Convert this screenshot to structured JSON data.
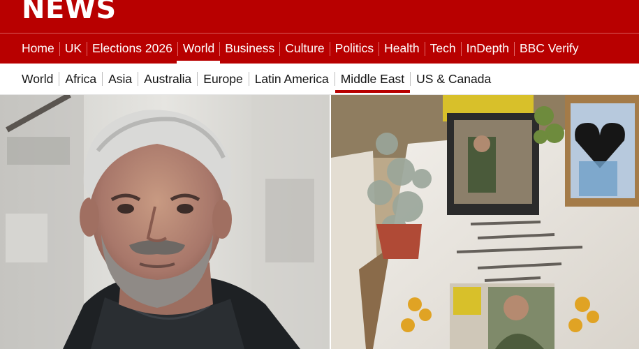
{
  "brand": {
    "logo_text": "NEWS",
    "color": "#b80000"
  },
  "primary_nav": {
    "active": "World",
    "items": [
      {
        "label": "Home"
      },
      {
        "label": "UK"
      },
      {
        "label": "Elections 2026"
      },
      {
        "label": "World"
      },
      {
        "label": "Business"
      },
      {
        "label": "Culture"
      },
      {
        "label": "Politics"
      },
      {
        "label": "Health"
      },
      {
        "label": "Tech"
      },
      {
        "label": "InDepth"
      },
      {
        "label": "BBC Verify"
      }
    ]
  },
  "secondary_nav": {
    "active": "Middle East",
    "items": [
      {
        "label": "World"
      },
      {
        "label": "Africa"
      },
      {
        "label": "Asia"
      },
      {
        "label": "Australia"
      },
      {
        "label": "Europe"
      },
      {
        "label": "Latin America"
      },
      {
        "label": "Middle East"
      },
      {
        "label": "US & Canada"
      }
    ]
  },
  "hero": {
    "left_photo": "portrait of grey-haired man in black puffer jacket",
    "right_photo": "grave with framed photographs, plants and flowers"
  }
}
